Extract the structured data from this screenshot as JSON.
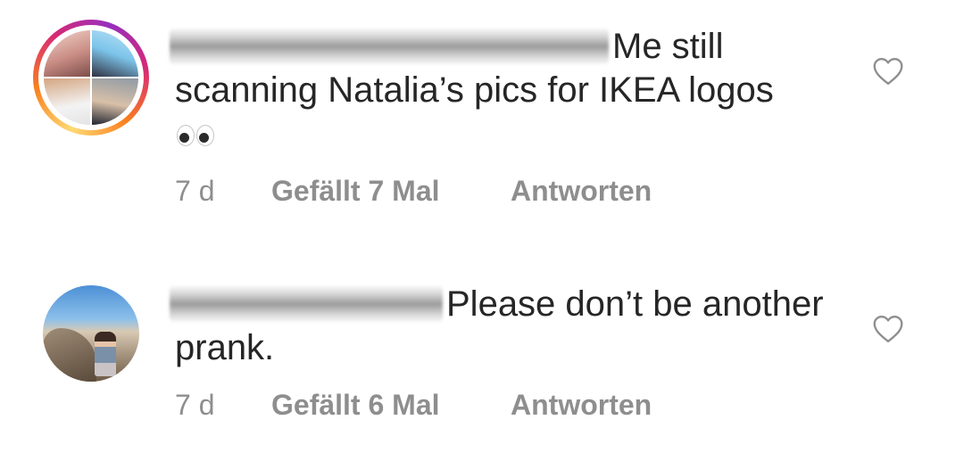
{
  "comments": [
    {
      "text": "Me still scanning Natalia’s pics for IKEA logos",
      "emoji": "eyes-emoji",
      "time": "7 d",
      "likes": "Gefällt 7 Mal",
      "reply": "Antworten",
      "like_icon": "heart-outline-icon"
    },
    {
      "text": "Please don’t be another prank.",
      "time": "7 d",
      "likes": "Gefällt 6 Mal",
      "reply": "Antworten",
      "like_icon": "heart-outline-icon"
    }
  ],
  "colors": {
    "text": "#262626",
    "meta": "#8e8e8e",
    "story_ring_start": "#feda75",
    "story_ring_end": "#d62976"
  }
}
